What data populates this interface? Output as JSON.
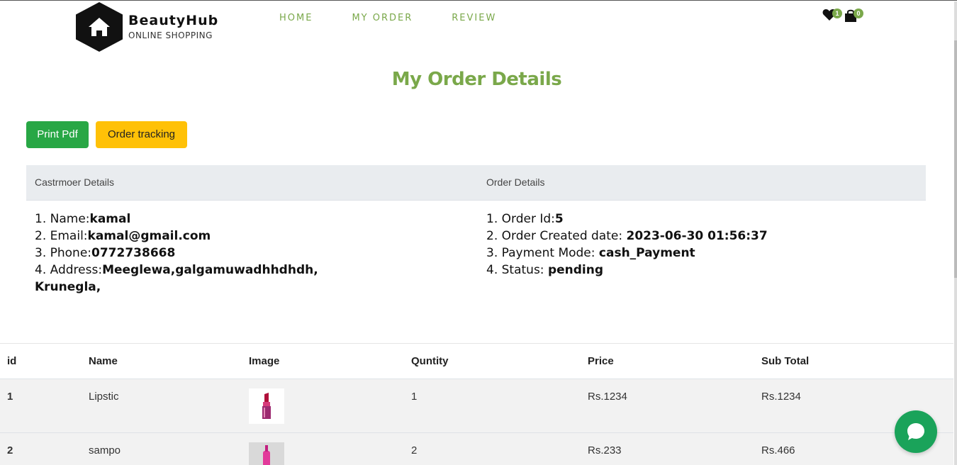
{
  "brand": {
    "name": "BeautyHub",
    "subtitle": "ONLINE SHOPPING"
  },
  "nav": {
    "items": [
      "HOME",
      "MY ORDER",
      "REVIEW"
    ]
  },
  "header_icons": {
    "wishlist_count": "1",
    "cart_count": "0"
  },
  "page": {
    "title": "My Order Details"
  },
  "actions": {
    "print_label": "Print Pdf",
    "tracking_label": "Order tracking"
  },
  "customer": {
    "heading": "Castrmoer Details",
    "name_label": "1. Name:",
    "name": "kamal",
    "email_label": "2. Email:",
    "email": "kamal@gmail.com",
    "phone_label": "3. Phone:",
    "phone": "0772738668",
    "address_label": "4. Address:",
    "address_line1": "Meeglewa,galgamuwadhhdhdh,",
    "address_line2": "Krunegla,"
  },
  "order": {
    "heading": "Order Details",
    "id_label": "1. Order Id:",
    "id": "5",
    "created_label": "2. Order Created date: ",
    "created": "2023-06-30 01:56:37",
    "payment_label": "3. Payment Mode: ",
    "payment": "cash_Payment",
    "status_label": "4. Status: ",
    "status": "pending"
  },
  "table": {
    "headers": [
      "id",
      "Name",
      "Image",
      "Quntity",
      "Price",
      "Sub Total"
    ],
    "rows": [
      {
        "id": "1",
        "name": "Lipstic",
        "qty": "1",
        "price": "Rs.1234",
        "subtotal": "Rs.1234"
      },
      {
        "id": "2",
        "name": "sampo",
        "qty": "2",
        "price": "Rs.233",
        "subtotal": "Rs.466"
      }
    ]
  },
  "colors": {
    "accent": "#7aa84a",
    "print_button": "#28a745",
    "tracking_button": "#ffc107",
    "chat_button": "#1aa35a"
  }
}
